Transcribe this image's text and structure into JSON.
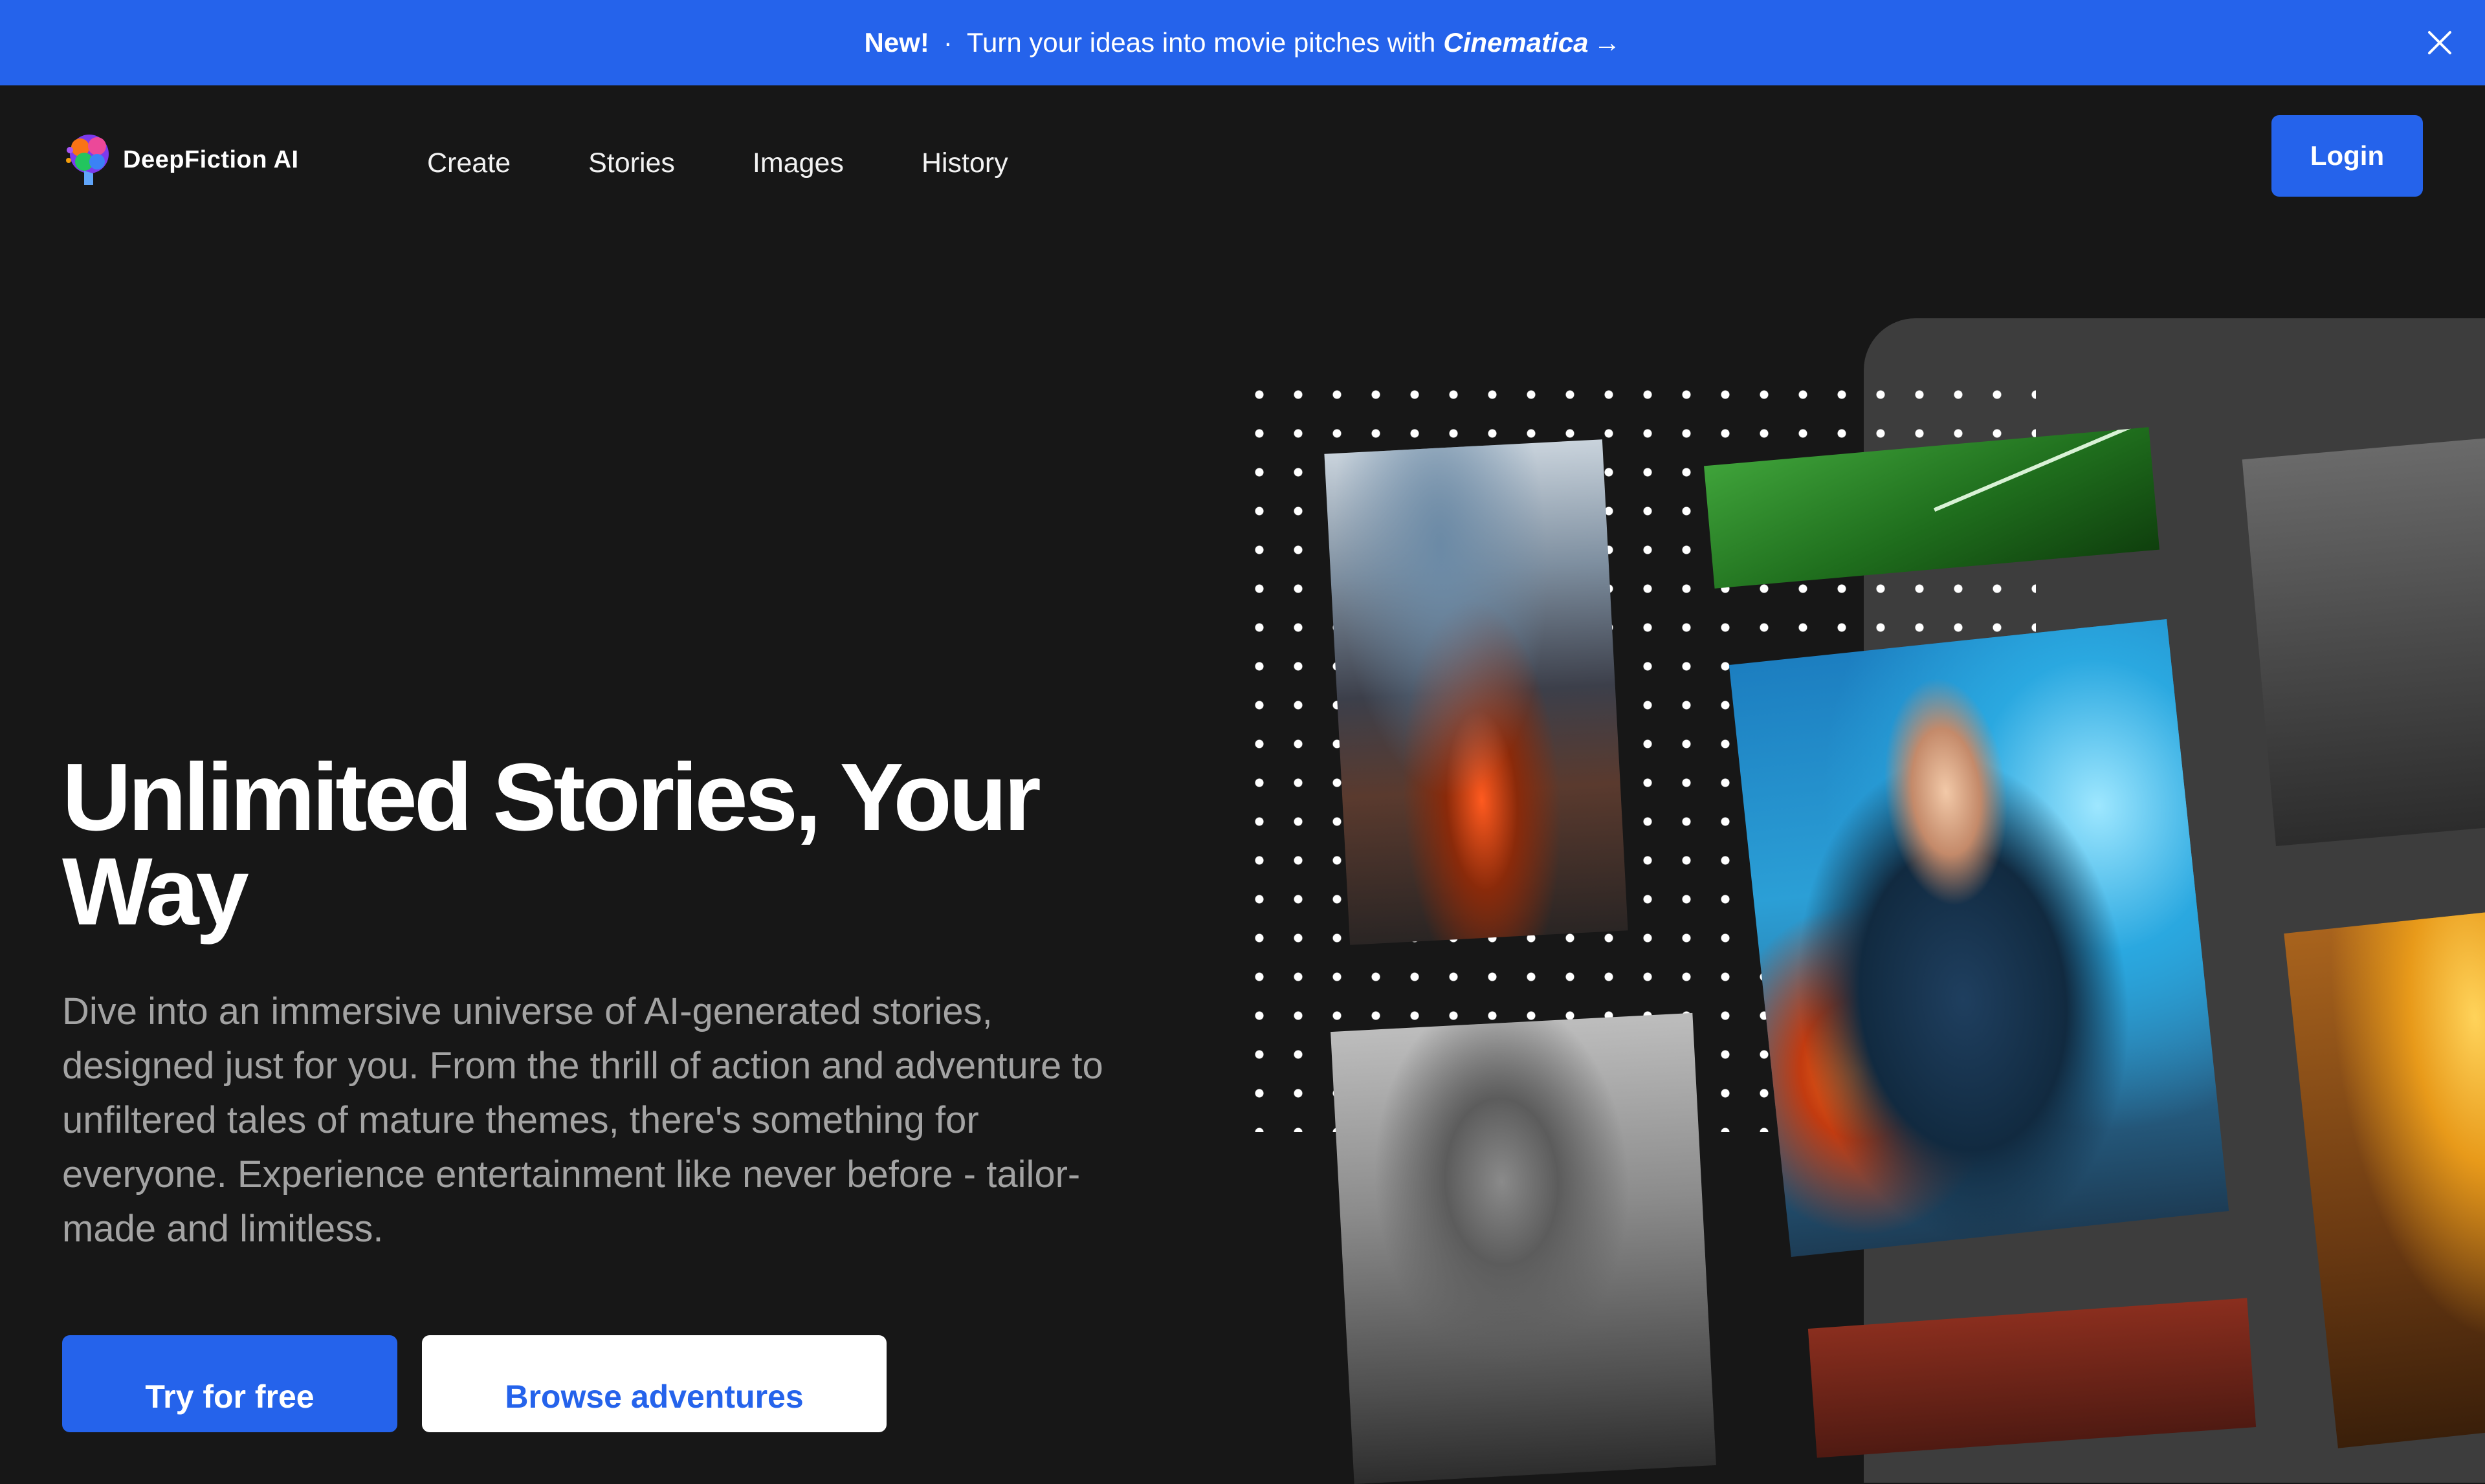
{
  "banner": {
    "new_label": "New!",
    "separator": "·",
    "message": "Turn your ideas into movie pitches with",
    "brand": "Cinematica",
    "arrow": "→",
    "close_icon": "close-icon"
  },
  "header": {
    "logo_text": "DeepFiction AI",
    "logo_icon": "brain-logo-icon",
    "nav": [
      "Create",
      "Stories",
      "Images",
      "History"
    ],
    "login_label": "Login"
  },
  "hero": {
    "title": "Unlimited Stories, Your Way",
    "description": "Dive into an immersive universe of AI-generated stories, designed just for you. From the thrill of action and adventure to unfiltered tales of mature themes, there's something for everyone. Experience entertainment like never before - tailor-made and limitless.",
    "cta_primary": "Try for free",
    "cta_secondary": "Browse adventures"
  },
  "gallery": {
    "cards": [
      "dragon-on-cliff",
      "green-field",
      "foggy-forest",
      "fire-mage-woman",
      "horned-beast",
      "golden-temple",
      "ember-sky"
    ]
  },
  "colors": {
    "accent": "#2563eb",
    "background": "#171717",
    "panel": "#3d3d3d",
    "muted_text": "#a3a3a3"
  }
}
